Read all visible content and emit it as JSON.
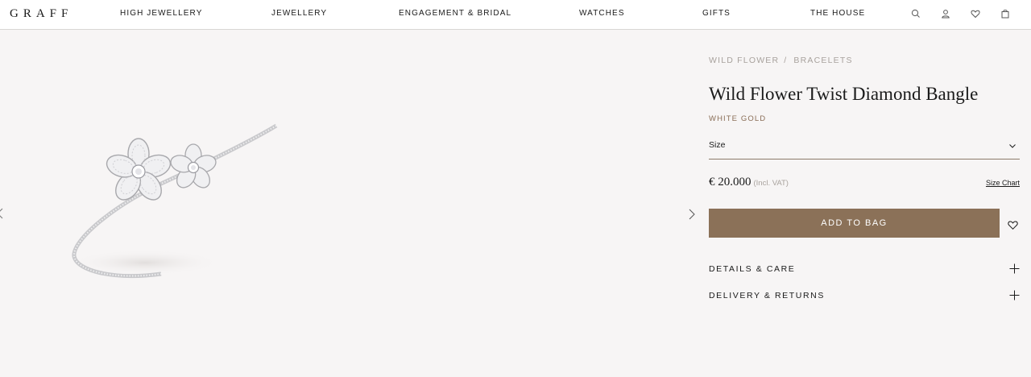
{
  "brand": {
    "logo": "GRAFF"
  },
  "nav": {
    "items": [
      {
        "label": "HIGH JEWELLERY"
      },
      {
        "label": "JEWELLERY"
      },
      {
        "label": "ENGAGEMENT & BRIDAL"
      },
      {
        "label": "WATCHES"
      },
      {
        "label": "GIFTS"
      },
      {
        "label": "THE HOUSE"
      }
    ],
    "icons": [
      "search-icon",
      "account-icon",
      "wishlist-icon",
      "bag-icon"
    ]
  },
  "breadcrumb": {
    "items": [
      {
        "label": "WILD FLOWER"
      },
      {
        "label": "BRACELETS"
      }
    ],
    "separator": "/"
  },
  "product": {
    "title": "Wild Flower Twist Diamond Bangle",
    "metal": "WHITE GOLD",
    "size_label": "Size",
    "price": "€ 20.000",
    "vat_note": "(Incl. VAT)",
    "size_chart_link": "Size Chart",
    "add_to_bag": "ADD TO BAG"
  },
  "accordions": [
    {
      "label": "DETAILS & CARE"
    },
    {
      "label": "DELIVERY & RETURNS"
    }
  ],
  "colors": {
    "accent": "#8b7158",
    "background": "#f7f5f5",
    "muted_text": "#a8a29d"
  }
}
